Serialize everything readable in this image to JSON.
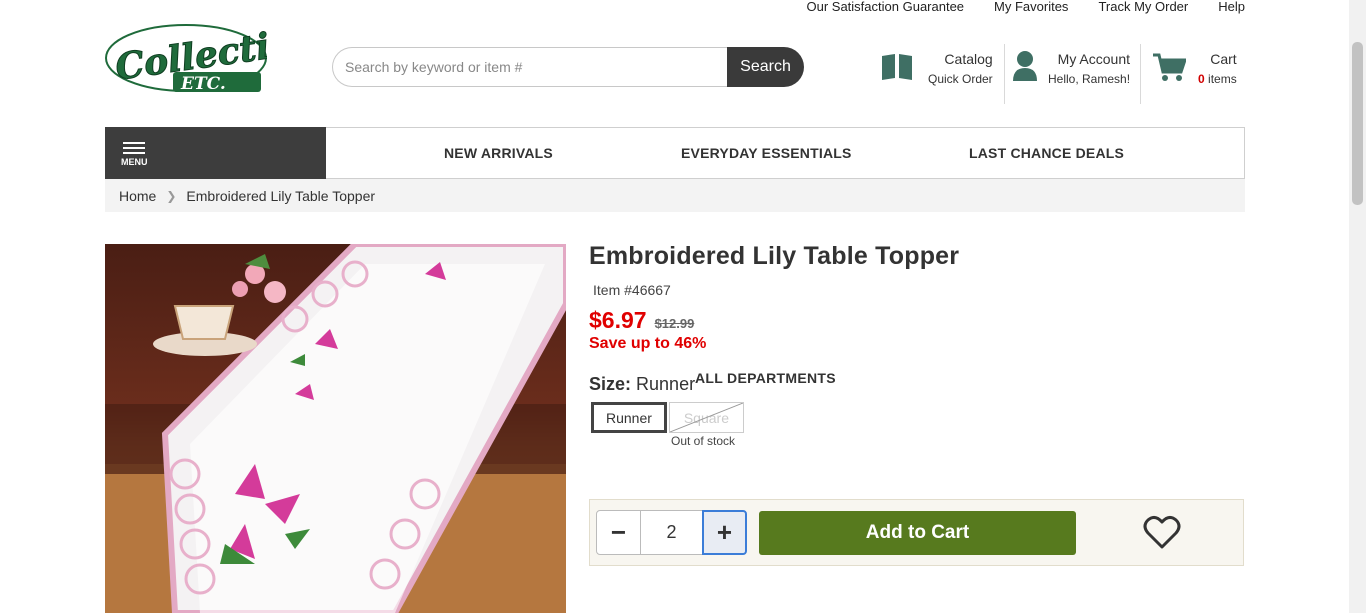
{
  "utility_links": [
    "Our Satisfaction Guarantee",
    "My Favorites",
    "Track My Order",
    "Help"
  ],
  "logo": {
    "line1": "Collections",
    "line2": "ETC"
  },
  "search": {
    "placeholder": "Search by keyword or item #",
    "button": "Search"
  },
  "header": {
    "catalog": {
      "title": "Catalog",
      "sub": "Quick Order",
      "icon": "book-icon"
    },
    "account": {
      "title": "My Account",
      "sub": "Hello, Ramesh!",
      "icon": "user-icon"
    },
    "cart": {
      "title": "Cart",
      "count": "0",
      "items_label": "items",
      "icon": "cart-icon"
    }
  },
  "nav": {
    "menu_label": "MENU",
    "all_departments": "ALL DEPARTMENTS",
    "links": [
      "NEW ARRIVALS",
      "EVERYDAY ESSENTIALS",
      "LAST CHANCE DEALS"
    ]
  },
  "breadcrumb": [
    "Home",
    "Embroidered Lily Table Topper"
  ],
  "product": {
    "title": "Embroidered Lily Table Topper",
    "item_no": "Item #46667",
    "price": "$6.97",
    "was_price": "$12.99",
    "save_text": "Save up to 46%",
    "size_label": "Size:",
    "size_value": "Runner",
    "sizes": [
      {
        "label": "Runner",
        "selected": true,
        "available": true
      },
      {
        "label": "Square",
        "selected": false,
        "available": false
      }
    ],
    "out_of_stock": "Out of stock",
    "quantity": "2",
    "add_to_cart": "Add to Cart"
  },
  "colors": {
    "price_red": "#e00000",
    "cart_green": "#577a1e",
    "header_icon": "#3f6f64",
    "dark": "#3d3d3d"
  }
}
